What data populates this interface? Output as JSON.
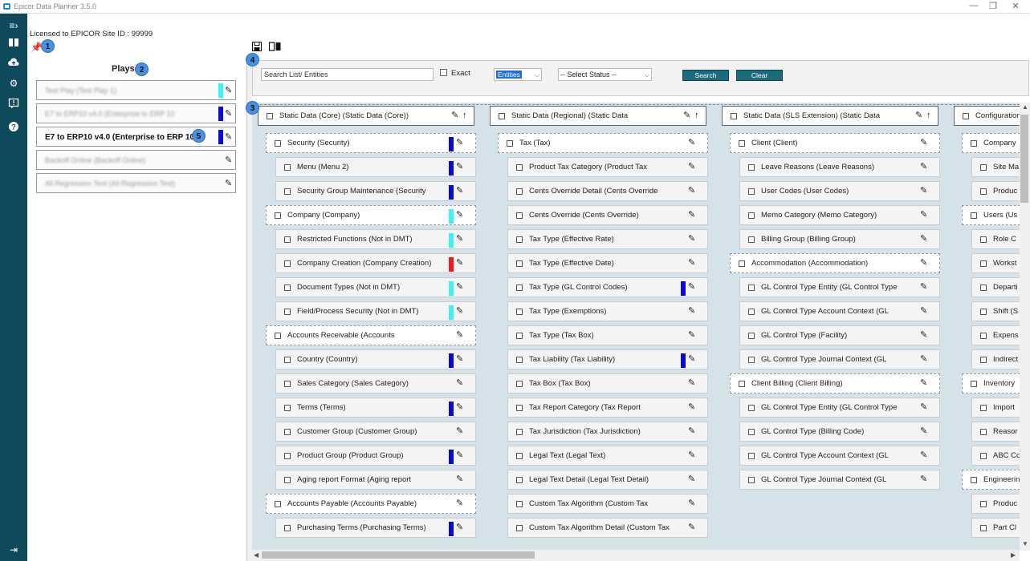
{
  "window": {
    "title": "Epicor Data Planner 3.5.0"
  },
  "header": {
    "license": "Licensed to EPICOR Site ID : 99999"
  },
  "badges": [
    "1",
    "2",
    "3",
    "4",
    "5"
  ],
  "plays": {
    "title": "Plays",
    "items": [
      {
        "label": "Test Play (Test Play 1)",
        "color": "#3ff2f2"
      },
      {
        "label": "E7 to ERP10 v4.0 (Enterprise to ERP 10",
        "color": "#0a0ad6"
      },
      {
        "label": "E7 to ERP10 v4.0 (Enterprise to ERP 10",
        "color": "#0a0ad6"
      },
      {
        "label": "Backoff Online (Backoff Online)",
        "color": ""
      },
      {
        "label": "All Regression Test (All Regression Test)",
        "color": ""
      }
    ]
  },
  "search": {
    "placeholder": "Search List/ Entities",
    "exact_label": "Exact",
    "entity_select": "Entities",
    "status_select": "-- Select Status --",
    "search_button": "Search",
    "clear_button": "Clear"
  },
  "columns": [
    {
      "items": [
        {
          "label": "Static Data (Core) (Static Data (Core))",
          "kind": "top"
        },
        {
          "label": "Security (Security)",
          "kind": "group",
          "color": "#0a0ad6"
        },
        {
          "label": "Menu (Menu 2)",
          "kind": "item",
          "color": "#0a0ad6"
        },
        {
          "label": "Security Group Maintenance (Security",
          "kind": "item",
          "color": "#0a0ad6"
        },
        {
          "label": "Company (Company)",
          "kind": "group",
          "color": "#3ff2f2"
        },
        {
          "label": "Restricted Functions (Not in DMT)",
          "kind": "item",
          "color": "#3ff2f2"
        },
        {
          "label": "Company Creation (Company Creation)",
          "kind": "item",
          "color": "#f21a1a"
        },
        {
          "label": "Document Types (Not in DMT)",
          "kind": "item",
          "color": "#3ff2f2"
        },
        {
          "label": "Field/Process Security (Not in DMT)",
          "kind": "item",
          "color": "#3ff2f2"
        },
        {
          "label": "Accounts Receivable (Accounts",
          "kind": "group",
          "color": ""
        },
        {
          "label": "Country (Country)",
          "kind": "item",
          "color": "#0a0ad6"
        },
        {
          "label": "Sales Category (Sales Category)",
          "kind": "item",
          "color": ""
        },
        {
          "label": "Terms (Terms)",
          "kind": "item",
          "color": "#0a0ad6"
        },
        {
          "label": "Customer Group (Customer Group)",
          "kind": "item",
          "color": ""
        },
        {
          "label": "Product Group (Product Group)",
          "kind": "item",
          "color": "#0a0ad6"
        },
        {
          "label": "Aging report Format (Aging report",
          "kind": "item",
          "color": ""
        },
        {
          "label": "Accounts Payable (Accounts Payable)",
          "kind": "group",
          "color": ""
        },
        {
          "label": "Purchasing Terms (Purchasing Terms)",
          "kind": "item",
          "color": "#0a0ad6"
        }
      ]
    },
    {
      "items": [
        {
          "label": "Static Data (Regional) (Static Data",
          "kind": "top"
        },
        {
          "label": "Tax (Tax)",
          "kind": "group",
          "color": ""
        },
        {
          "label": "Product Tax Category (Product Tax",
          "kind": "item",
          "color": ""
        },
        {
          "label": "Cents Override Detail (Cents Override",
          "kind": "item",
          "color": ""
        },
        {
          "label": "Cents Override (Cents Override)",
          "kind": "item",
          "color": ""
        },
        {
          "label": "Tax Type (Effective Rate)",
          "kind": "item",
          "color": ""
        },
        {
          "label": "Tax Type (Effective Date)",
          "kind": "item",
          "color": ""
        },
        {
          "label": "Tax Type (GL Control Codes)",
          "kind": "item",
          "color": "#0a0ad6"
        },
        {
          "label": "Tax Type (Exemptions)",
          "kind": "item",
          "color": ""
        },
        {
          "label": "Tax Type (Tax Box)",
          "kind": "item",
          "color": ""
        },
        {
          "label": "Tax Liability (Tax Liability)",
          "kind": "item",
          "color": "#0a0ad6"
        },
        {
          "label": "Tax Box (Tax Box)",
          "kind": "item",
          "color": ""
        },
        {
          "label": "Tax Report Category (Tax Report",
          "kind": "item",
          "color": ""
        },
        {
          "label": "Tax Jurisdiction (Tax Jurisdiction)",
          "kind": "item",
          "color": ""
        },
        {
          "label": "Legal Text (Legal Text)",
          "kind": "item",
          "color": ""
        },
        {
          "label": "Legal Text Detail (Legal Text Detail)",
          "kind": "item",
          "color": ""
        },
        {
          "label": "Custom Tax Algorithm (Custom Tax",
          "kind": "item",
          "color": ""
        },
        {
          "label": "Custom Tax Algorithm Detail (Custom Tax",
          "kind": "item",
          "color": ""
        }
      ]
    },
    {
      "items": [
        {
          "label": "Static Data (SLS Extension) (Static Data",
          "kind": "top"
        },
        {
          "label": "Client (Client)",
          "kind": "group",
          "color": ""
        },
        {
          "label": "Leave Reasons (Leave Reasons)",
          "kind": "item",
          "color": ""
        },
        {
          "label": "User Codes (User Codes)",
          "kind": "item",
          "color": ""
        },
        {
          "label": "Memo Category (Memo Category)",
          "kind": "item",
          "color": ""
        },
        {
          "label": "Billing Group (Billing Group)",
          "kind": "item",
          "color": ""
        },
        {
          "label": "Accommodation (Accommodation)",
          "kind": "group",
          "color": ""
        },
        {
          "label": "GL Control Type Entity (GL Control Type",
          "kind": "item",
          "color": ""
        },
        {
          "label": "GL Control Type Account Context (GL",
          "kind": "item",
          "color": ""
        },
        {
          "label": "GL Control Type (Facility)",
          "kind": "item",
          "color": ""
        },
        {
          "label": "GL Control Type Journal Context (GL",
          "kind": "item",
          "color": ""
        },
        {
          "label": "Client Billing (Client Billing)",
          "kind": "group",
          "color": ""
        },
        {
          "label": "GL Control Type Entity (GL Control Type",
          "kind": "item",
          "color": ""
        },
        {
          "label": "GL Control Type (Billing Code)",
          "kind": "item",
          "color": ""
        },
        {
          "label": "GL Control Type Account Context (GL",
          "kind": "item",
          "color": ""
        },
        {
          "label": "GL Control Type Journal Context (GL",
          "kind": "item",
          "color": ""
        }
      ]
    },
    {
      "items": [
        {
          "label": "Configuration",
          "kind": "top"
        },
        {
          "label": "Company",
          "kind": "group"
        },
        {
          "label": "Site Ma",
          "kind": "item"
        },
        {
          "label": "Produc",
          "kind": "item"
        },
        {
          "label": "Users (Us",
          "kind": "group"
        },
        {
          "label": "Role C",
          "kind": "item"
        },
        {
          "label": "Workst",
          "kind": "item"
        },
        {
          "label": "Departi",
          "kind": "item"
        },
        {
          "label": "Shift (S",
          "kind": "item"
        },
        {
          "label": "Expens",
          "kind": "item"
        },
        {
          "label": "Indirect",
          "kind": "item"
        },
        {
          "label": "Inventory",
          "kind": "group"
        },
        {
          "label": "Import",
          "kind": "item"
        },
        {
          "label": "Reasor",
          "kind": "item"
        },
        {
          "label": "ABC Co",
          "kind": "item"
        },
        {
          "label": "Engineerin",
          "kind": "group"
        },
        {
          "label": "Produc",
          "kind": "item"
        },
        {
          "label": "Part Cl",
          "kind": "item"
        }
      ]
    }
  ]
}
